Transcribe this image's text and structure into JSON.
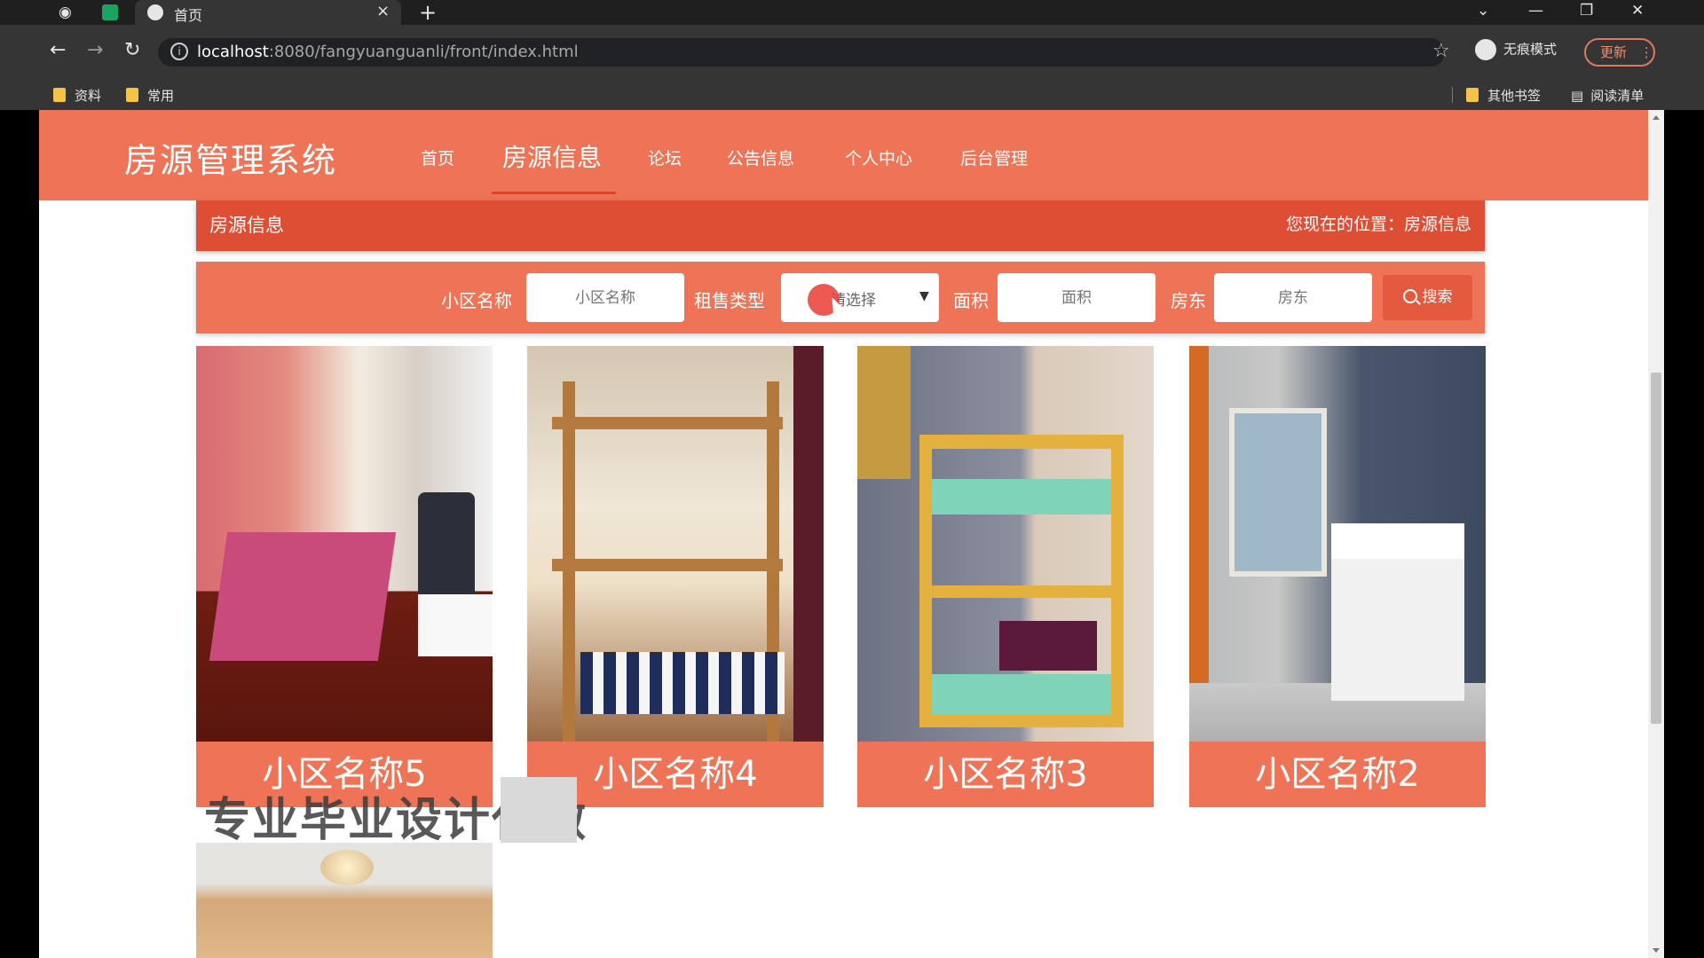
{
  "browser": {
    "tabs": [
      {
        "title": "首页",
        "active": true
      }
    ],
    "url_host": "localhost",
    "url_rest": ":8080/fangyuanguanli/front/index.html",
    "incognito_label": "无痕模式",
    "update_label": "更新",
    "bookmarks": [
      {
        "label": "资料"
      },
      {
        "label": "常用"
      }
    ],
    "bookmarks_right": [
      {
        "label": "其他书签"
      },
      {
        "label": "阅读清单"
      }
    ]
  },
  "site": {
    "title": "房源管理系统",
    "nav": [
      {
        "label": "首页"
      },
      {
        "label": "房源信息",
        "active": true
      },
      {
        "label": "论坛"
      },
      {
        "label": "公告信息"
      },
      {
        "label": "个人中心"
      },
      {
        "label": "后台管理"
      }
    ],
    "breadcrumb": {
      "title": "房源信息",
      "location": "您现在的位置：房源信息"
    },
    "search": {
      "community_label": "小区名称",
      "community_placeholder": "小区名称",
      "rent_type_label": "租售类型",
      "rent_type_value": "请选择",
      "area_label": "面积",
      "area_placeholder": "面积",
      "landlord_label": "房东",
      "landlord_placeholder": "房东",
      "button_label": "搜索"
    },
    "cards": [
      {
        "name": "小区名称5"
      },
      {
        "name": "小区名称4"
      },
      {
        "name": "小区名称3"
      },
      {
        "name": "小区名称2"
      }
    ],
    "watermark": "专业毕业设计代做"
  },
  "colors": {
    "primary": "#ef7457",
    "dark_primary": "#de4e34",
    "button": "#e35a3e"
  }
}
